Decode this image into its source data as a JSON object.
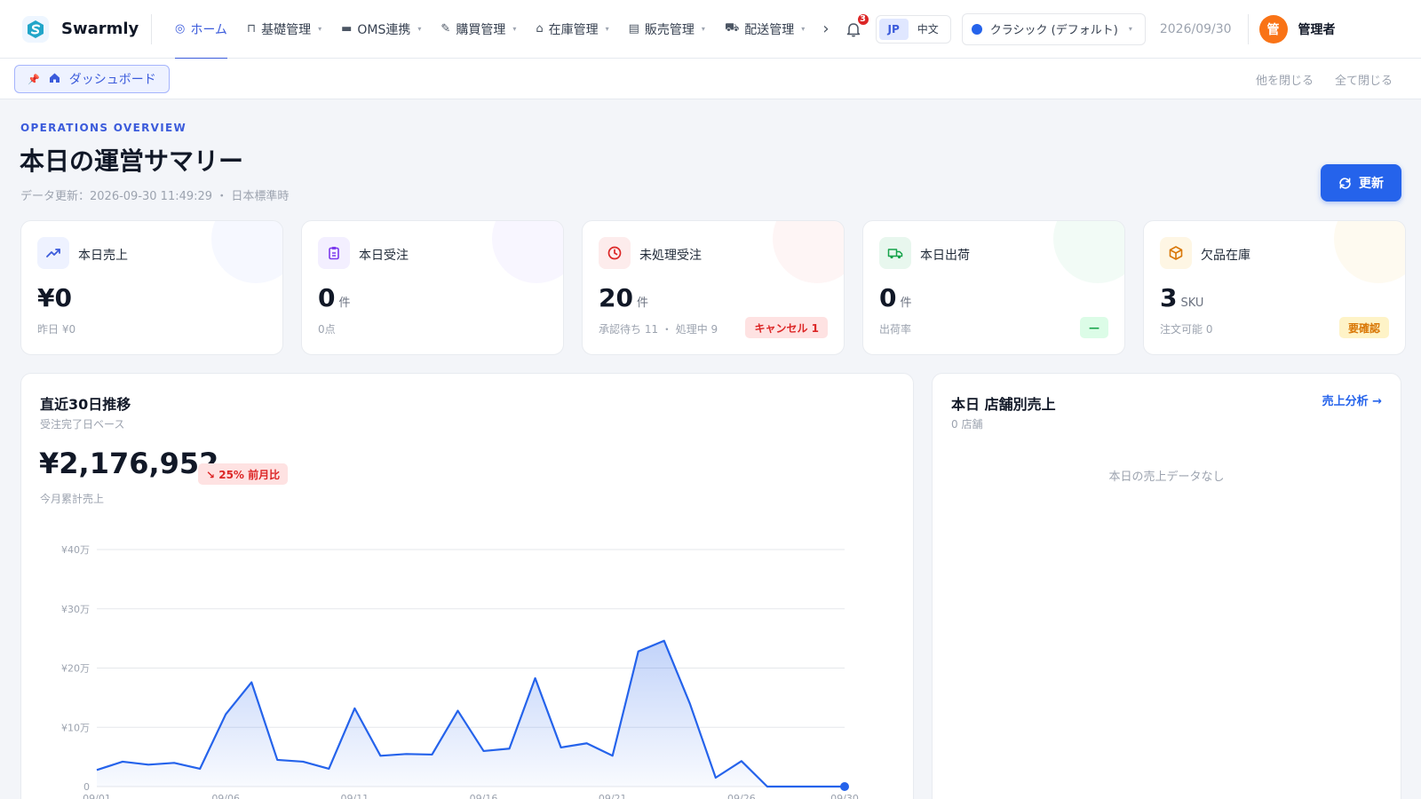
{
  "app": {
    "name": "Swarmly"
  },
  "nav": {
    "items": [
      {
        "label": "ホーム",
        "icon": "◎",
        "icon_name": "dashboard-icon",
        "active": true,
        "caret": false
      },
      {
        "label": "基礎管理",
        "icon": "⊓",
        "icon_name": "bag-icon",
        "active": false,
        "caret": true
      },
      {
        "label": "OMS連携",
        "icon": "▬",
        "icon_name": "server-icon",
        "active": false,
        "caret": true
      },
      {
        "label": "購買管理",
        "icon": "✎",
        "icon_name": "pen-icon",
        "active": false,
        "caret": true
      },
      {
        "label": "在庫管理",
        "icon": "⌂",
        "icon_name": "warehouse-icon",
        "active": false,
        "caret": true
      },
      {
        "label": "販売管理",
        "icon": "▤",
        "icon_name": "document-icon",
        "active": false,
        "caret": true
      },
      {
        "label": "配送管理",
        "icon": "⛟",
        "icon_name": "truck-icon",
        "active": false,
        "caret": true
      }
    ],
    "more": "›"
  },
  "notifications": {
    "count": "3"
  },
  "lang": {
    "options": [
      "JP",
      "中文"
    ],
    "active": "JP"
  },
  "theme": {
    "label": "クラシック (デフォルト)",
    "color": "#2563eb"
  },
  "date": "2026/09/30",
  "user": {
    "avatar": "管",
    "name": "管理者"
  },
  "tabs": {
    "items": [
      {
        "label": "ダッシュボード"
      }
    ],
    "close_others": "他を閉じる",
    "close_all": "全て閉じる"
  },
  "header": {
    "eyebrow": "OPERATIONS OVERVIEW",
    "title": "本日の運営サマリー",
    "subtitle": "データ更新：2026-09-30 11:49:29 ・ 日本標準時",
    "refresh": "更新"
  },
  "kpis": [
    {
      "label": "本日売上",
      "value": "¥0",
      "unit": "",
      "foot": "昨日 ¥0",
      "tag": "",
      "accent": "#3b5bdb",
      "bg": "#eef2ff",
      "icon": "trend-up-icon"
    },
    {
      "label": "本日受注",
      "value": "0",
      "unit": "件",
      "foot": "0点",
      "tag": "",
      "accent": "#7c3aed",
      "bg": "#f3efff",
      "icon": "clipboard-icon"
    },
    {
      "label": "未処理受注",
      "value": "20",
      "unit": "件",
      "foot": "承認待ち 11 ・ 処理中 9",
      "tag": "キャンセル 1",
      "tag_color": "#dc2626",
      "tag_bg": "#fee2e2",
      "accent": "#dc2626",
      "bg": "#fdecec",
      "icon": "clock-icon"
    },
    {
      "label": "本日出荷",
      "value": "0",
      "unit": "件",
      "foot": "出荷率",
      "tag": "—",
      "tag_color": "#16a34a",
      "tag_bg": "#dcfce7",
      "accent": "#16a34a",
      "bg": "#e8f7ee",
      "icon": "truck-icon"
    },
    {
      "label": "欠品在庫",
      "value": "3",
      "unit": "SKU",
      "foot": "注文可能 0",
      "tag": "要確認",
      "tag_color": "#d97706",
      "tag_bg": "#fef3c7",
      "accent": "#d97706",
      "bg": "#fef6e4",
      "icon": "box-icon"
    }
  ],
  "trend": {
    "title": "直近30日推移",
    "subtitle": "受注完了日ベース",
    "total": "¥2,176,952",
    "mom": "↘ 25% 前月比",
    "total_label": "今月累計売上"
  },
  "store": {
    "title": "本日 店舗別売上",
    "subtitle": "0 店舗",
    "link": "売上分析 →",
    "empty": "本日の売上データなし"
  },
  "chart_data": {
    "type": "area",
    "x": [
      "09/01",
      "09/02",
      "09/03",
      "09/04",
      "09/05",
      "09/06",
      "09/07",
      "09/08",
      "09/09",
      "09/10",
      "09/11",
      "09/12",
      "09/13",
      "09/14",
      "09/15",
      "09/16",
      "09/17",
      "09/18",
      "09/19",
      "09/20",
      "09/21",
      "09/22",
      "09/23",
      "09/24",
      "09/25",
      "09/26",
      "09/27",
      "09/28",
      "09/29",
      "09/30"
    ],
    "x_ticks": [
      "09/01",
      "09/06",
      "09/11",
      "09/16",
      "09/21",
      "09/26",
      "09/30"
    ],
    "y_ticks": [
      "0",
      "¥10万",
      "¥20万",
      "¥30万",
      "¥40万"
    ],
    "ylim": [
      0,
      400000
    ],
    "series": [
      {
        "values": [
          28000,
          42000,
          37000,
          40000,
          30000,
          122000,
          176000,
          45000,
          42000,
          30000,
          132000,
          52000,
          55000,
          54000,
          128000,
          60000,
          64000,
          183000,
          66000,
          73000,
          52000,
          228000,
          246000,
          140000,
          15000,
          43000,
          0,
          0,
          0,
          0
        ]
      }
    ],
    "color": "#2563eb",
    "grid": true
  }
}
